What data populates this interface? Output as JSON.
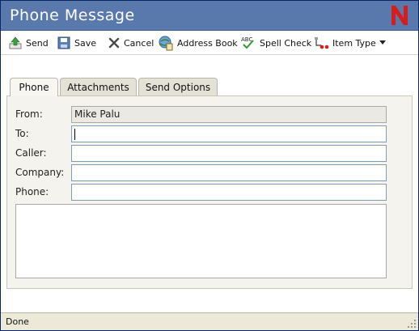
{
  "window": {
    "title": "Phone Message",
    "logo_letter": "N",
    "colors": {
      "titlebar": "#5979ac",
      "logo": "#d41e1e",
      "panel": "#f4f3ee"
    }
  },
  "toolbar": {
    "items": [
      {
        "label": "Send",
        "icon": "send-icon"
      },
      {
        "label": "Save",
        "icon": "save-icon"
      },
      {
        "label": "Cancel",
        "icon": "cancel-icon"
      },
      {
        "label": "Address Book",
        "icon": "address-book-icon"
      },
      {
        "label": "Spell Check",
        "icon": "spell-check-icon"
      },
      {
        "label": "Item Type",
        "icon": "item-type-icon",
        "has_dropdown": true
      }
    ]
  },
  "tabs": [
    {
      "label": "Phone",
      "active": true
    },
    {
      "label": "Attachments",
      "active": false
    },
    {
      "label": "Send Options",
      "active": false
    }
  ],
  "form": {
    "from": {
      "label": "From:",
      "value": "Mike Palu"
    },
    "to": {
      "label": "To:",
      "value": ""
    },
    "caller": {
      "label": "Caller:",
      "value": ""
    },
    "company": {
      "label": "Company:",
      "value": ""
    },
    "phone": {
      "label": "Phone:",
      "value": ""
    },
    "message": ""
  },
  "status": {
    "text": "Done"
  }
}
